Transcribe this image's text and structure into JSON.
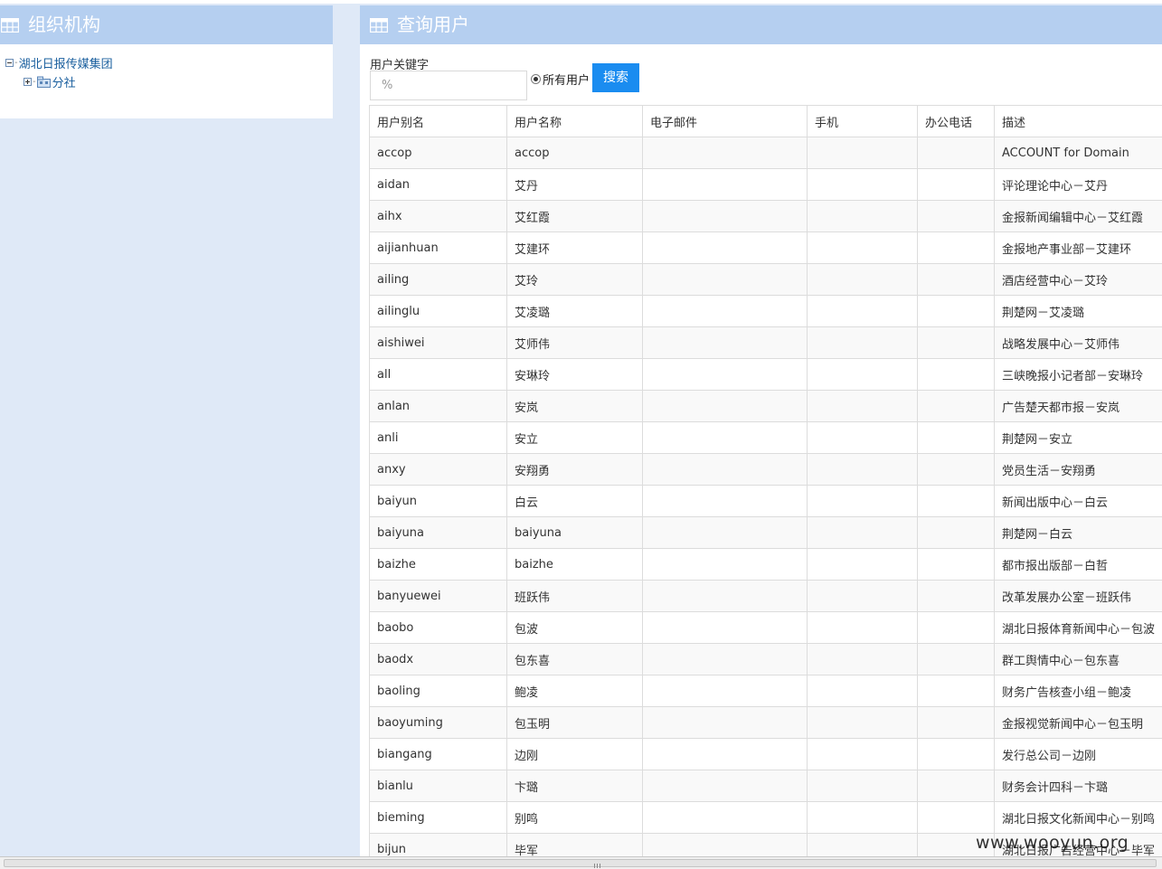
{
  "left_panel": {
    "title": "组织机构",
    "tree": {
      "root_label": "湖北日报传媒集团",
      "children": [
        {
          "label": "分社"
        }
      ]
    }
  },
  "right_panel": {
    "title": "查询用户",
    "search": {
      "keyword_label": "用户关键字",
      "keyword_placeholder": "%",
      "radio_label": "所有用户",
      "button_label": "搜索"
    },
    "table": {
      "headers": [
        "用户别名",
        "用户名称",
        "电子邮件",
        "手机",
        "办公电话",
        "描述"
      ],
      "rows": [
        [
          "accop",
          "accop",
          "",
          "",
          "",
          "ACCOUNT for Domain"
        ],
        [
          "aidan",
          "艾丹",
          "",
          "",
          "",
          "评论理论中心－艾丹"
        ],
        [
          "aihx",
          "艾红霞",
          "",
          "",
          "",
          "金报新闻编辑中心－艾红霞"
        ],
        [
          "aijianhuan",
          "艾建环",
          "",
          "",
          "",
          "金报地产事业部－艾建环"
        ],
        [
          "ailing",
          "艾玲",
          "",
          "",
          "",
          "酒店经营中心－艾玲"
        ],
        [
          "ailinglu",
          "艾凌璐",
          "",
          "",
          "",
          "荆楚网－艾凌璐"
        ],
        [
          "aishiwei",
          "艾师伟",
          "",
          "",
          "",
          "战略发展中心－艾师伟"
        ],
        [
          "all",
          "安琳玲",
          "",
          "",
          "",
          "三峡晚报小记者部－安琳玲"
        ],
        [
          "anlan",
          "安岚",
          "",
          "",
          "",
          "广告楚天都市报－安岚"
        ],
        [
          "anli",
          "安立",
          "",
          "",
          "",
          "荆楚网－安立"
        ],
        [
          "anxy",
          "安翔勇",
          "",
          "",
          "",
          "党员生活－安翔勇"
        ],
        [
          "baiyun",
          "白云",
          "",
          "",
          "",
          "新闻出版中心－白云"
        ],
        [
          "baiyuna",
          "baiyuna",
          "",
          "",
          "",
          "荆楚网－白云"
        ],
        [
          "baizhe",
          "baizhe",
          "",
          "",
          "",
          "都市报出版部－白哲"
        ],
        [
          "banyuewei",
          "班跃伟",
          "",
          "",
          "",
          "改革发展办公室－班跃伟"
        ],
        [
          "baobo",
          "包波",
          "",
          "",
          "",
          "湖北日报体育新闻中心－包波"
        ],
        [
          "baodx",
          "包东喜",
          "",
          "",
          "",
          "群工舆情中心－包东喜"
        ],
        [
          "baoling",
          "鲍凌",
          "",
          "",
          "",
          "财务广告核查小组－鲍凌"
        ],
        [
          "baoyuming",
          "包玉明",
          "",
          "",
          "",
          "金报视觉新闻中心－包玉明"
        ],
        [
          "biangang",
          "边刚",
          "",
          "",
          "",
          "发行总公司－边刚"
        ],
        [
          "bianlu",
          "卞璐",
          "",
          "",
          "",
          "财务会计四科－卞璐"
        ],
        [
          "bieming",
          "别鸣",
          "",
          "",
          "",
          "湖北日报文化新闻中心－别鸣"
        ],
        [
          "bijun",
          "毕军",
          "",
          "",
          "",
          "湖北日报广告经营中心－毕军"
        ]
      ]
    }
  },
  "watermark": "www.wooyun.org",
  "icons": {
    "header_icon": "grid-table-icon",
    "tree_collapse": "minus-box-icon",
    "tree_expand": "plus-box-icon",
    "tree_node": "org-unit-icon"
  },
  "colors": {
    "header_bg": "#b5cff0",
    "page_bg": "#dfe9f7",
    "button_bg": "#1a8cf0",
    "link": "#1a5f9e"
  }
}
